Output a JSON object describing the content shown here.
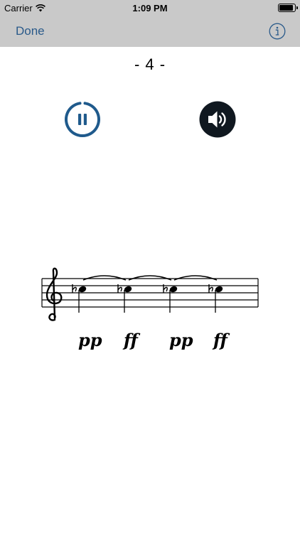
{
  "status_bar": {
    "carrier": "Carrier",
    "time": "1:09 PM",
    "battery_level": 0.95
  },
  "nav": {
    "done_label": "Done",
    "info_icon": "info-icon",
    "accent": "#2a5a8a"
  },
  "exercise": {
    "number_label": "- 4 -"
  },
  "controls": {
    "pause_icon": "pause-circle-icon",
    "sound_icon": "speaker-icon",
    "pause_color": "#1f5a8c"
  },
  "notation": {
    "clef": "treble",
    "notes": [
      "Db5",
      "Db5",
      "Db5",
      "Db5"
    ],
    "dynamics": [
      "pp",
      "ff",
      "pp",
      "ff"
    ]
  }
}
